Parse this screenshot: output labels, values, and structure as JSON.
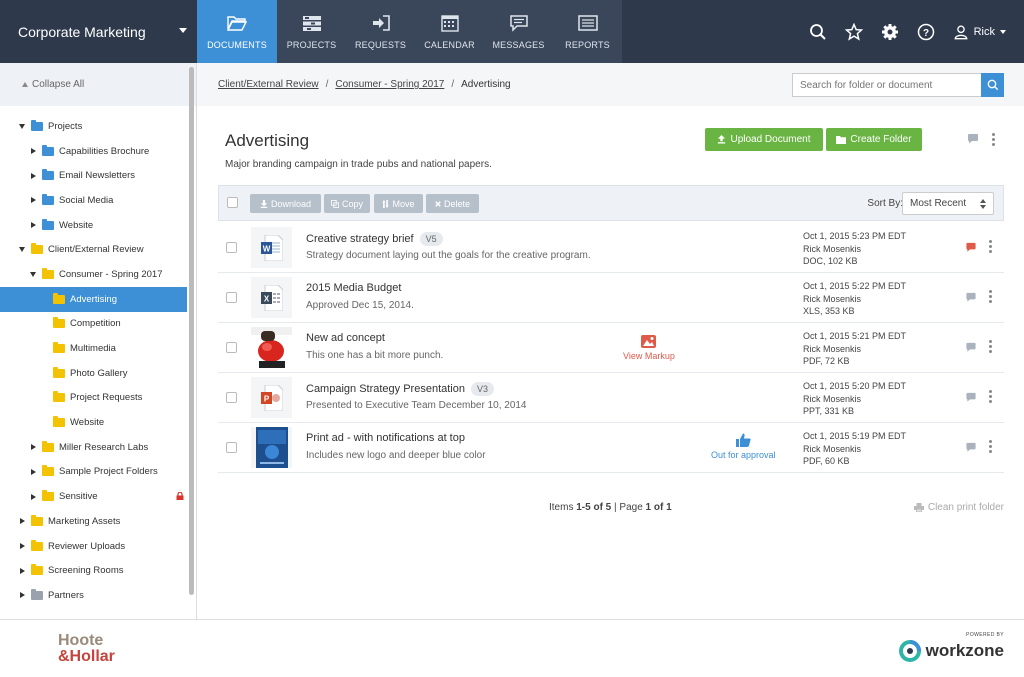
{
  "header": {
    "workspace": "Corporate Marketing",
    "nav": [
      {
        "label": "DOCUMENTS",
        "icon": "folder-open-icon",
        "active": true
      },
      {
        "label": "PROJECTS",
        "icon": "projects-icon"
      },
      {
        "label": "REQUESTS",
        "icon": "requests-icon"
      },
      {
        "label": "CALENDAR",
        "icon": "calendar-icon"
      },
      {
        "label": "MESSAGES",
        "icon": "messages-icon"
      },
      {
        "label": "REPORTS",
        "icon": "reports-icon"
      }
    ],
    "user": "Rick"
  },
  "sidebar": {
    "collapse_label": "Collapse All",
    "tree": [
      {
        "label": "Projects",
        "depth": 0,
        "arrow": "down",
        "color": "blue"
      },
      {
        "label": "Capabilities Brochure",
        "depth": 1,
        "arrow": "right",
        "color": "blue"
      },
      {
        "label": "Email Newsletters",
        "depth": 1,
        "arrow": "right",
        "color": "blue"
      },
      {
        "label": "Social Media",
        "depth": 1,
        "arrow": "right",
        "color": "blue"
      },
      {
        "label": "Website",
        "depth": 1,
        "arrow": "right",
        "color": "blue"
      },
      {
        "label": "Client/External Review",
        "depth": 0,
        "arrow": "down",
        "color": "yellow"
      },
      {
        "label": "Consumer - Spring 2017",
        "depth": 1,
        "arrow": "down",
        "color": "yellow"
      },
      {
        "label": "Advertising",
        "depth": 2,
        "arrow": "none",
        "color": "yellow",
        "selected": true
      },
      {
        "label": "Competition",
        "depth": 2,
        "arrow": "none",
        "color": "yellow"
      },
      {
        "label": "Multimedia",
        "depth": 2,
        "arrow": "none",
        "color": "yellow"
      },
      {
        "label": "Photo Gallery",
        "depth": 2,
        "arrow": "none",
        "color": "yellow"
      },
      {
        "label": "Project Requests",
        "depth": 2,
        "arrow": "none",
        "color": "yellow"
      },
      {
        "label": "Website",
        "depth": 2,
        "arrow": "none",
        "color": "yellow"
      },
      {
        "label": "Miller Research Labs",
        "depth": 1,
        "arrow": "right",
        "color": "yellow"
      },
      {
        "label": "Sample Project Folders",
        "depth": 1,
        "arrow": "right",
        "color": "yellow"
      },
      {
        "label": "Sensitive",
        "depth": 1,
        "arrow": "right",
        "color": "yellow",
        "locked": true
      },
      {
        "label": "Marketing Assets",
        "depth": 0,
        "arrow": "right",
        "color": "yellow"
      },
      {
        "label": "Reviewer Uploads",
        "depth": 0,
        "arrow": "right",
        "color": "yellow"
      },
      {
        "label": "Screening Rooms",
        "depth": 0,
        "arrow": "right",
        "color": "yellow"
      },
      {
        "label": "Partners",
        "depth": 0,
        "arrow": "right",
        "color": "gray"
      }
    ]
  },
  "breadcrumb": {
    "items": [
      "Client/External Review",
      "Consumer - Spring 2017"
    ],
    "current": "Advertising",
    "separator": "/"
  },
  "search": {
    "placeholder": "Search for folder or document"
  },
  "folder": {
    "title": "Advertising",
    "description": "Major branding campaign in trade pubs and national papers.",
    "upload_label": "Upload Document",
    "create_label": "Create Folder"
  },
  "toolbar": {
    "download": "Download",
    "copy": "Copy",
    "move": "Move",
    "delete": "Delete",
    "sort_label": "Sort By:",
    "sort_value": "Most Recent"
  },
  "documents": [
    {
      "title": "Creative strategy brief",
      "version": "V5",
      "desc": "Strategy document laying out the goals for the creative program.",
      "date": "Oct 1, 2015 5:23 PM EDT",
      "owner": "Rick Mosenkis",
      "info": "DOC, 102 KB",
      "thumb": "word",
      "comment_active": true
    },
    {
      "title": "2015 Media Budget",
      "version": "",
      "desc": "Approved Dec 15, 2014.",
      "date": "Oct 1, 2015 5:22 PM EDT",
      "owner": "Rick Mosenkis",
      "info": "XLS, 353 KB",
      "thumb": "excel"
    },
    {
      "title": "New ad concept",
      "version": "",
      "desc": "This one has a bit more punch.",
      "date": "Oct 1, 2015 5:21 PM EDT",
      "owner": "Rick Mosenkis",
      "info": "PDF, 72 KB",
      "thumb": "photo",
      "status": "View Markup",
      "status_kind": "markup"
    },
    {
      "title": "Campaign Strategy Presentation",
      "version": "V3",
      "desc": "Presented to Executive Team December 10, 2014",
      "date": "Oct 1, 2015 5:20 PM EDT",
      "owner": "Rick Mosenkis",
      "info": "PPT, 331 KB",
      "thumb": "ppt"
    },
    {
      "title": "Print ad - with notifications at top",
      "version": "",
      "desc": "Includes new logo and deeper blue color",
      "date": "Oct 1, 2015 5:19 PM EDT",
      "owner": "Rick Mosenkis",
      "info": "PDF, 60 KB",
      "thumb": "print",
      "status": "Out for approval",
      "status_kind": "approval"
    }
  ],
  "pager": {
    "text_a": "Items ",
    "range": "1-5 of 5",
    "text_b": " | Page ",
    "page": "1 of 1"
  },
  "clean_print": "Clean print folder",
  "footer": {
    "logo_line1": "Hoote",
    "logo_line2": "&Hollar",
    "powered_by": "POWERED BY",
    "brand": "workzone"
  },
  "colors": {
    "accent": "#3d8fd6",
    "nav_bg": "#2e3a4c",
    "green": "#6ab443",
    "markup_red": "#e05a4a"
  }
}
